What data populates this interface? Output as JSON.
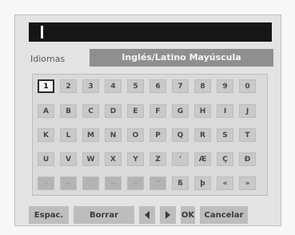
{
  "language": {
    "label": "Idiomas",
    "value": "Inglés/Latino Mayúscula"
  },
  "keyboard": {
    "rows": [
      [
        "1",
        "2",
        "3",
        "4",
        "5",
        "6",
        "7",
        "8",
        "9",
        "0"
      ],
      [
        "A",
        "B",
        "C",
        "D",
        "E",
        "F",
        "G",
        "H",
        "I",
        "J"
      ],
      [
        "K",
        "L",
        "M",
        "N",
        "O",
        "P",
        "Q",
        "R",
        "S",
        "T"
      ],
      [
        "U",
        "V",
        "W",
        "X",
        "Y",
        "Z",
        "'",
        "Æ",
        "Ç",
        "Ð"
      ],
      [
        "-",
        "~",
        "`",
        "~",
        "~",
        "^",
        "ß",
        "þ",
        "«",
        "»"
      ]
    ],
    "selected": "1"
  },
  "buttons": {
    "space": "Espac.",
    "delete": "Borrar",
    "left_icon": "left-arrow-icon",
    "right_icon": "right-arrow-icon",
    "ok": "OK",
    "cancel": "Cancelar"
  }
}
